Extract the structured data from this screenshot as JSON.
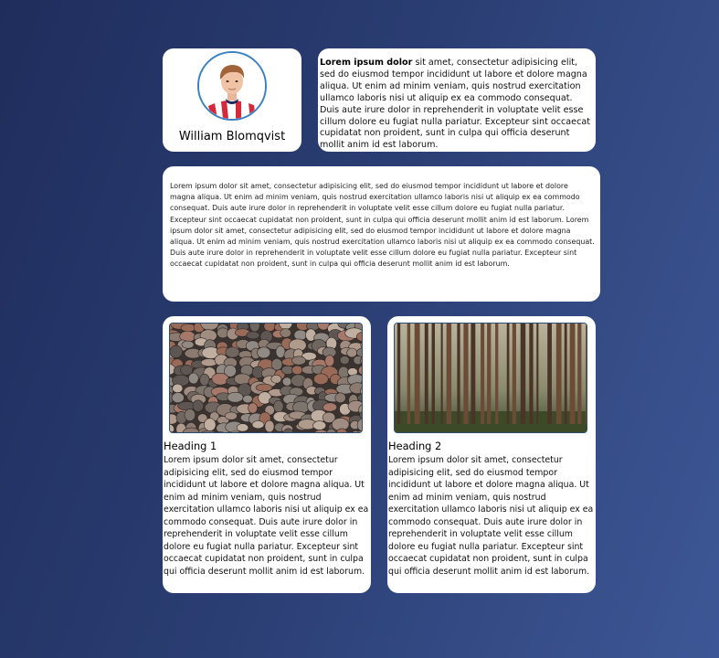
{
  "profile": {
    "name": "William Blomqvist"
  },
  "intro": {
    "bold": "Lorem ipsum dolor",
    "text": " sit amet, consectetur adipisicing elit, sed do eiusmod tempor incididunt ut labore et dolore magna aliqua. Ut enim ad minim veniam, quis nostrud exercitation ullamco laboris nisi ut aliquip ex ea commodo consequat. Duis aute irure dolor in reprehenderit in voluptate velit esse cillum dolore eu fugiat nulla pariatur. Excepteur sint occaecat cupidatat non proident, sunt in culpa qui officia deserunt mollit anim id est laborum."
  },
  "longtext": {
    "text": "Lorem ipsum dolor sit amet, consectetur adipisicing elit, sed do eiusmod tempor incididunt ut labore et dolore magna aliqua. Ut enim ad minim veniam, quis nostrud exercitation ullamco laboris nisi ut aliquip ex ea commodo consequat. Duis aute irure dolor in reprehenderit in voluptate velit esse cillum dolore eu fugiat nulla pariatur. Excepteur sint occaecat cupidatat non proident, sunt in culpa qui officia deserunt mollit anim id est laborum. Lorem ipsum dolor sit amet, consectetur adipisicing elit, sed do eiusmod tempor incididunt ut labore et dolore magna aliqua. Ut enim ad minim veniam, quis nostrud exercitation ullamco laboris nisi ut aliquip ex ea commodo consequat. Duis aute irure dolor in reprehenderit in voluptate velit esse cillum dolore eu fugiat nulla pariatur. Excepteur sint occaecat cupidatat non proident, sunt in culpa qui officia deserunt mollit anim id est laborum."
  },
  "cards": [
    {
      "heading": "Heading 1",
      "text": "Lorem ipsum dolor sit amet, consectetur adipisicing elit, sed do eiusmod tempor incididunt ut labore et dolore magna aliqua. Ut enim ad minim veniam, quis nostrud exercitation ullamco laboris nisi ut aliquip ex ea commodo consequat. Duis aute irure dolor in reprehenderit in voluptate velit esse cillum dolore eu fugiat nulla pariatur. Excepteur sint occaecat cupidatat non proident, sunt in culpa qui officia deserunt mollit anim id est laborum."
    },
    {
      "heading": "Heading 2",
      "text": "Lorem ipsum dolor sit amet, consectetur adipisicing elit, sed do eiusmod tempor incididunt ut labore et dolore magna aliqua. Ut enim ad minim veniam, quis nostrud exercitation ullamco laboris nisi ut aliquip ex ea commodo consequat. Duis aute irure dolor in reprehenderit in voluptate velit esse cillum dolore eu fugiat nulla pariatur. Excepteur sint occaecat cupidatat non proident, sunt in culpa qui officia deserunt mollit anim id est laborum."
    }
  ],
  "colors": {
    "background_start": "#1f2d5c",
    "background_end": "#3d5796",
    "card": "#ffffff",
    "avatar_border": "#3b82c4"
  }
}
